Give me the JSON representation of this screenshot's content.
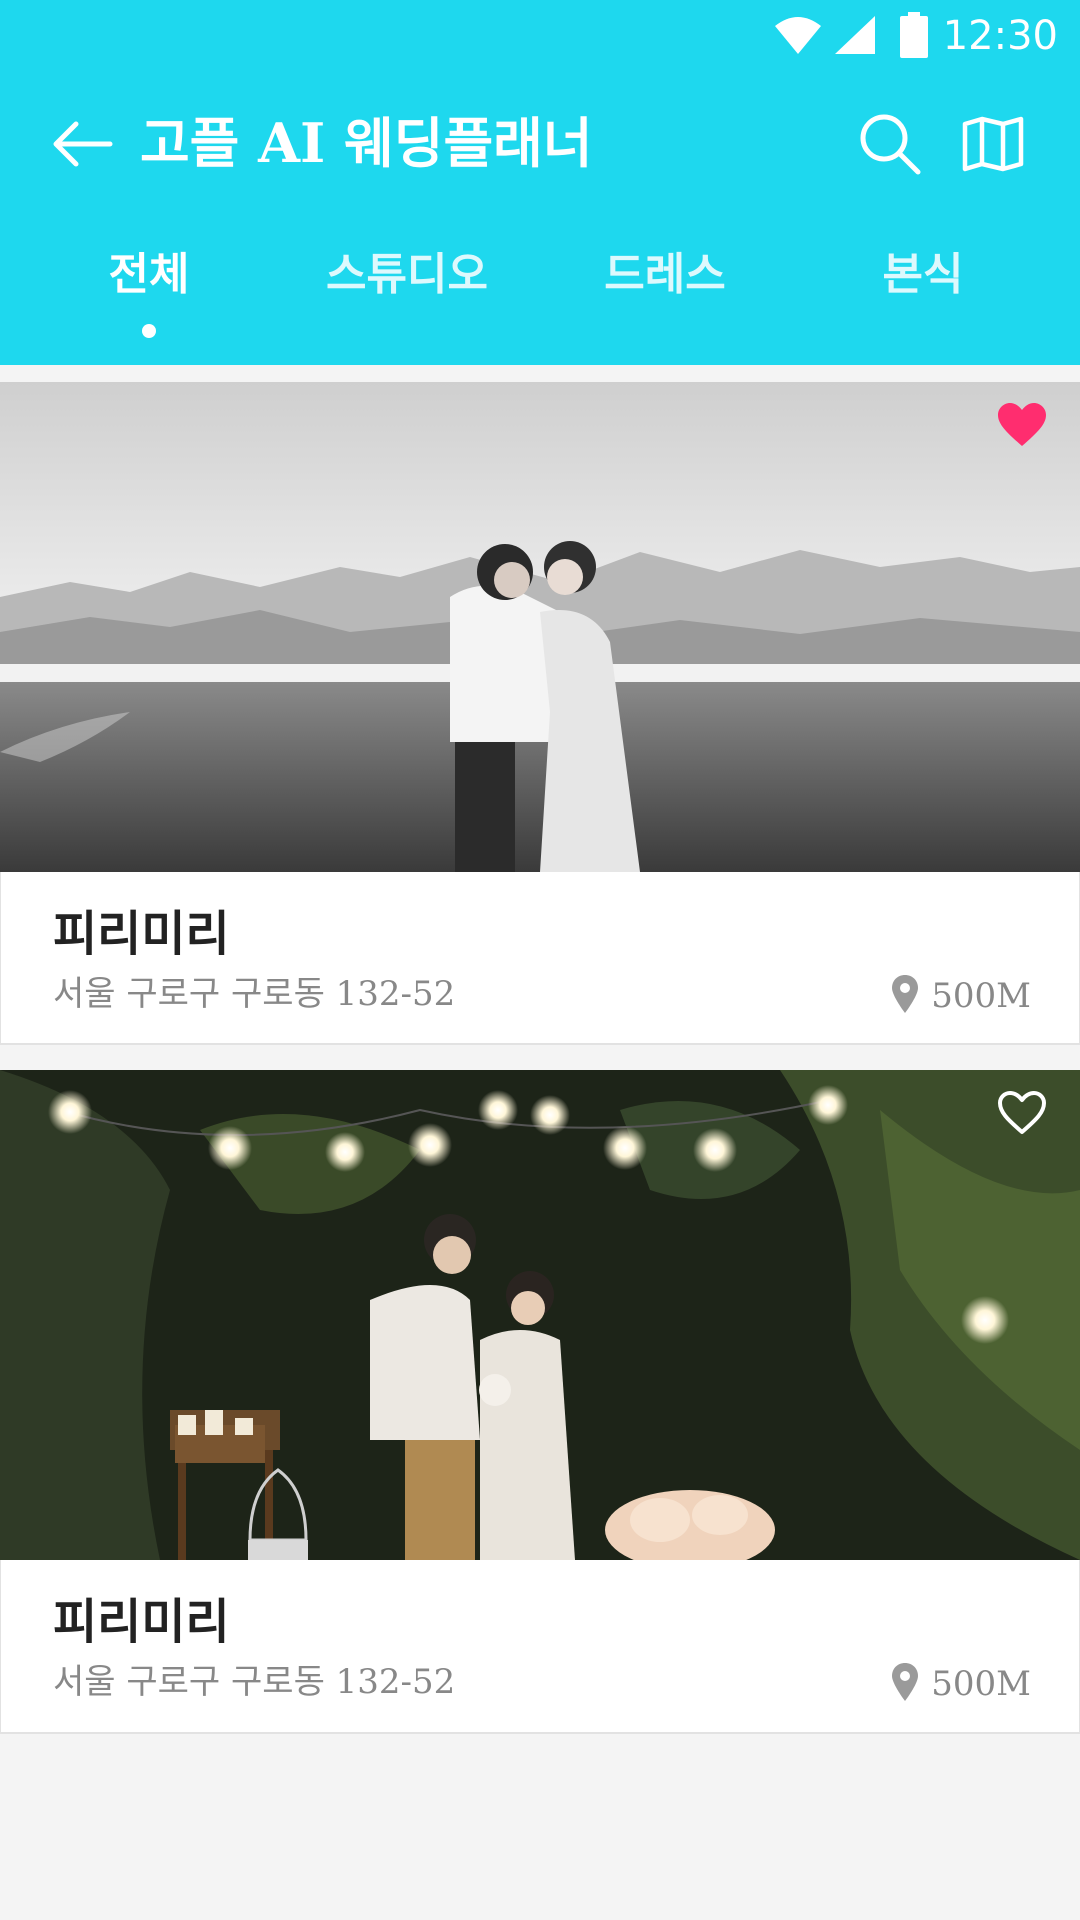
{
  "status_bar": {
    "time": "12:30",
    "icons": [
      "wifi-icon",
      "cell-signal-icon",
      "battery-icon"
    ]
  },
  "toolbar": {
    "title": "고플 AI 웨딩플래너",
    "back_icon": "arrow-left-icon",
    "search_icon": "search-icon",
    "map_icon": "map-icon"
  },
  "tabs": [
    {
      "label": "전체",
      "active": true
    },
    {
      "label": "스튜디오",
      "active": false
    },
    {
      "label": "드레스",
      "active": false
    },
    {
      "label": "본식",
      "active": false
    }
  ],
  "colors": {
    "primary": "#1ed8ee",
    "favorite": "#ff2d6f",
    "background": "#f4f4f4",
    "text_primary": "#222222",
    "text_secondary": "#888888"
  },
  "listings": [
    {
      "name": "피리미리",
      "address": "서울 구로구 구로동 132-52",
      "distance": "500M",
      "favorited": true,
      "photo": "black-and-white photo of couple embracing on a beach with mountains"
    },
    {
      "name": "피리미리",
      "address": "서울 구로구 구로동 132-52",
      "distance": "500M",
      "favorited": false,
      "photo": "night garden photo of couple under string lights"
    }
  ]
}
